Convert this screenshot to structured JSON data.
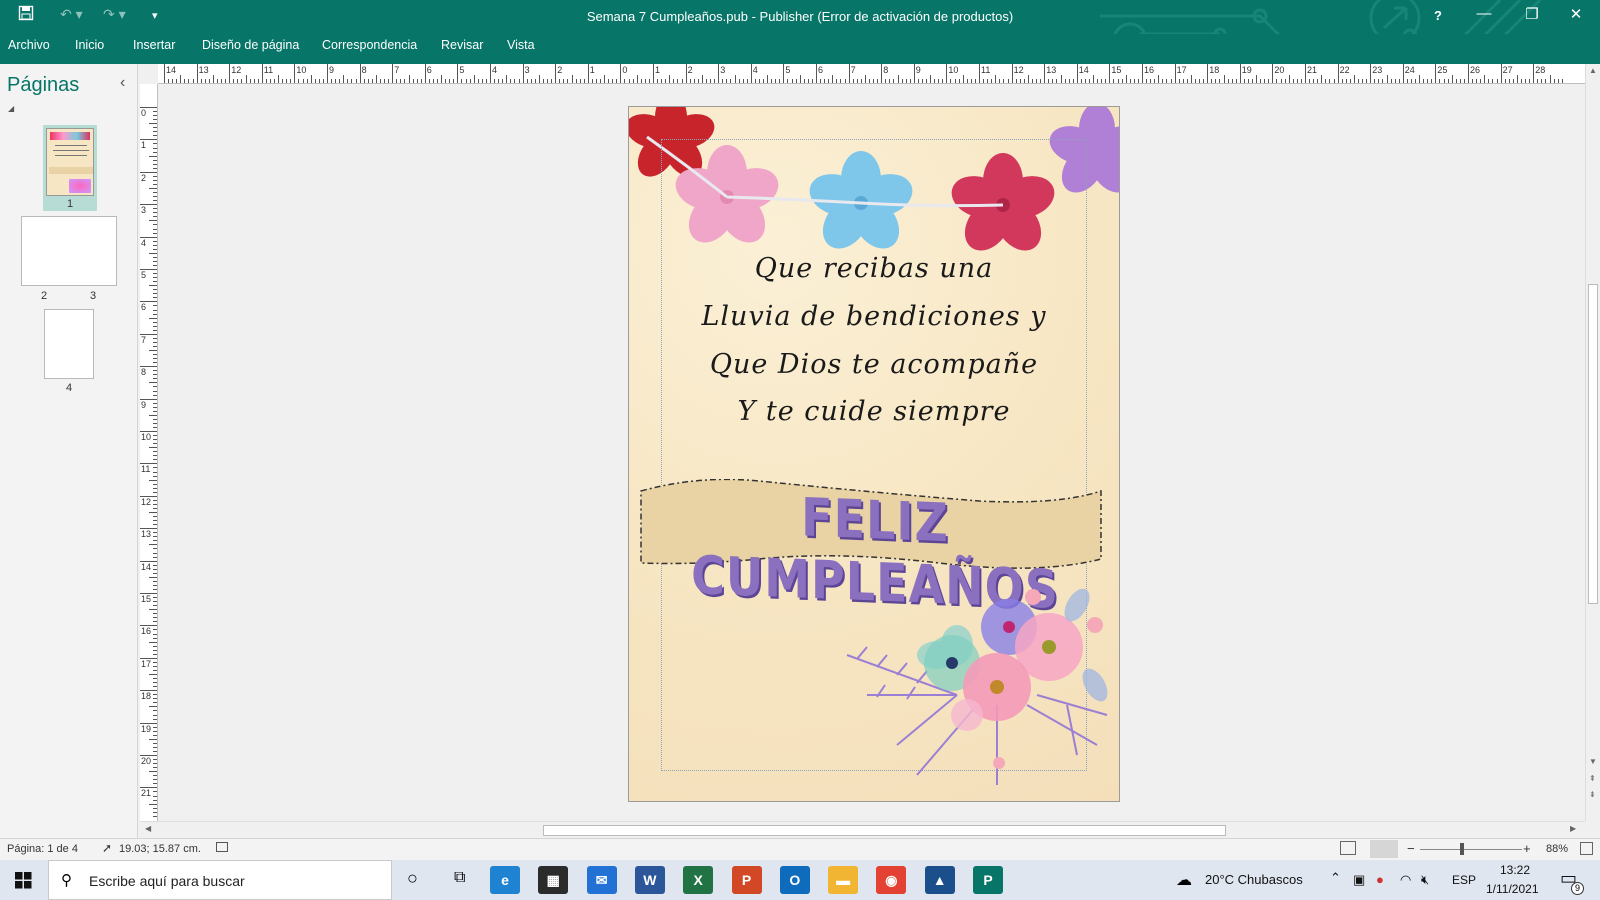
{
  "window": {
    "title": "Semana 7 Cumpleaños.pub - Publisher (Error de activación de productos)",
    "help_label": "?",
    "minimize_label": "—",
    "restore_label": "❐",
    "close_label": "✕"
  },
  "quick_access": {
    "save_icon": "save-icon",
    "undo_icon": "undo-icon",
    "redo_icon": "redo-icon",
    "customize_icon": "customize-icon"
  },
  "menu": {
    "items": [
      "Archivo",
      "Inicio",
      "Insertar",
      "Diseño de página",
      "Correspondencia",
      "Revisar",
      "Vista"
    ]
  },
  "pages_pane": {
    "title": "Páginas",
    "collapse_label": "‹",
    "thumbnails": [
      {
        "label": "1",
        "selected": true
      },
      {
        "label_left": "2",
        "label_right": "3"
      },
      {
        "label": "4"
      }
    ]
  },
  "ruler": {
    "h_ticks": [
      "14",
      "13",
      "12",
      "11",
      "10",
      "9",
      "8",
      "7",
      "6",
      "5",
      "4",
      "3",
      "2",
      "1",
      "0",
      "1",
      "2",
      "3",
      "4",
      "5",
      "6",
      "7",
      "8",
      "9",
      "10",
      "11",
      "12",
      "13",
      "14",
      "15",
      "16",
      "17",
      "18",
      "19",
      "20",
      "21",
      "22",
      "23",
      "24",
      "25",
      "26",
      "27",
      "28"
    ],
    "v_ticks": [
      "0",
      "1",
      "2",
      "3",
      "4",
      "5",
      "6",
      "7",
      "8",
      "9",
      "10",
      "11",
      "12",
      "13",
      "14",
      "15",
      "16",
      "17",
      "18",
      "19",
      "20",
      "21"
    ]
  },
  "card": {
    "verse": [
      "Que recibas una",
      "Lluvia de bendiciones y",
      "Que Dios te acompañe",
      "Y te cuide siempre"
    ],
    "banner": "FELIZ CUMPLEAÑOS",
    "background_color": "#f7e6c3",
    "banner_text_color": "#8a70be"
  },
  "status": {
    "page": "Página: 1 de 4",
    "position": "19.03; 15.87 cm.",
    "zoom": "88%"
  },
  "taskbar": {
    "search_placeholder": "Escribe aquí para buscar",
    "weather": "20°C  Chubascos",
    "language": "ESP",
    "time": "13:22",
    "date": "1/11/2021",
    "notifications": "9",
    "apps": [
      {
        "name": "edge",
        "color": "#1f83d1",
        "glyph": "e"
      },
      {
        "name": "store",
        "color": "#2b2b2b",
        "glyph": "▦"
      },
      {
        "name": "mail",
        "color": "#2272d6",
        "glyph": "✉"
      },
      {
        "name": "word",
        "color": "#2b579a",
        "glyph": "W"
      },
      {
        "name": "excel",
        "color": "#217346",
        "glyph": "X"
      },
      {
        "name": "powerpoint",
        "color": "#d24726",
        "glyph": "P"
      },
      {
        "name": "outlook",
        "color": "#0f6cbd",
        "glyph": "O"
      },
      {
        "name": "explorer",
        "color": "#f2b533",
        "glyph": "▬"
      },
      {
        "name": "chrome",
        "color": "#e34133",
        "glyph": "◉"
      },
      {
        "name": "photos",
        "color": "#1a4f8c",
        "glyph": "▲"
      },
      {
        "name": "publisher",
        "color": "#077568",
        "glyph": "P"
      }
    ]
  }
}
